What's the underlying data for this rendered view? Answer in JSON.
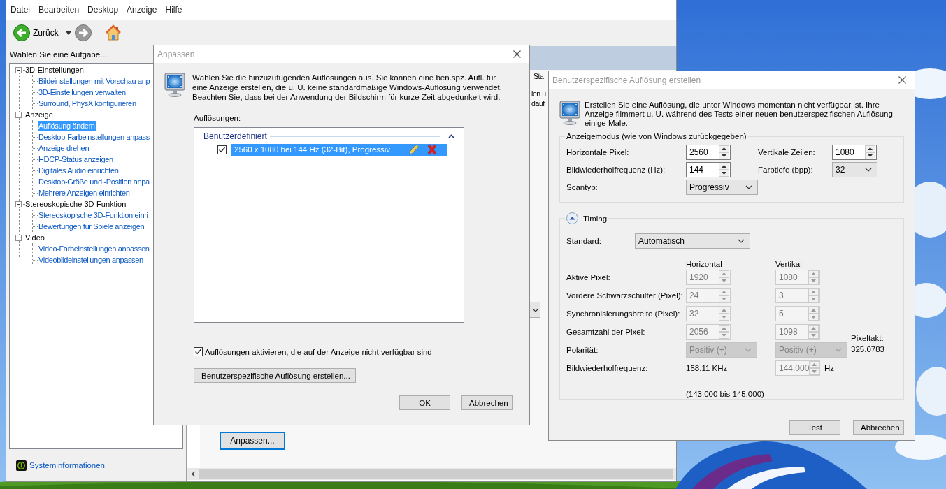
{
  "main_window": {
    "menu": [
      "Datei",
      "Bearbeiten",
      "Desktop",
      "Anzeige",
      "Hilfe"
    ],
    "toolbar": {
      "back": "Zurück"
    },
    "task_prompt": "Wählen Sie eine Aufgabe...",
    "tree": [
      {
        "label": "3D-Einstellungen",
        "expanded": true,
        "children": [
          {
            "label": "Bildeinstellungen mit Vorschau anp",
            "selected": false
          },
          {
            "label": "3D-Einstellungen verwalten",
            "selected": false
          },
          {
            "label": "Surround, PhysX konfigurieren",
            "selected": false
          }
        ]
      },
      {
        "label": "Anzeige",
        "expanded": true,
        "children": [
          {
            "label": "Auflösung ändern",
            "selected": true
          },
          {
            "label": "Desktop-Farbeinstellungen anpass",
            "selected": false
          },
          {
            "label": "Anzeige drehen",
            "selected": false
          },
          {
            "label": "HDCP-Status anzeigen",
            "selected": false
          },
          {
            "label": "Digitales Audio einrichten",
            "selected": false
          },
          {
            "label": "Desktop-Größe und -Position anpa",
            "selected": false
          },
          {
            "label": "Mehrere Anzeigen einrichten",
            "selected": false
          }
        ]
      },
      {
        "label": "Stereoskopische 3D-Funktion",
        "expanded": true,
        "children": [
          {
            "label": "Stereoskopische 3D-Funktion einri",
            "selected": false
          },
          {
            "label": "Bewertungen für Spiele anzeigen",
            "selected": false
          }
        ]
      },
      {
        "label": "Video",
        "expanded": true,
        "children": [
          {
            "label": "Video-Farbeinstellungen anpassen",
            "selected": false
          },
          {
            "label": "Videobildeinstellungen anpassen",
            "selected": false
          }
        ]
      }
    ],
    "footer_link": "Systeminformationen",
    "content": {
      "heading_fragment": "Sta",
      "text_fragments": [
        "len u",
        "dauf"
      ],
      "button": "Anpassen..."
    }
  },
  "customize_dialog": {
    "title": "Anpassen",
    "description": "Wählen Sie die hinzuzufügenden Auflösungen aus. Sie können eine ben.spz. Aufl. für eine Anzeige erstellen, die u. U. keine standardmäßige Windows-Auflösung verwendet. Beachten Sie, dass bei der Anwendung der Bildschirm für kurze Zeit abgedunkelt wird.",
    "list_label": "Auflösungen:",
    "groups": [
      {
        "label": "Benutzerdefiniert",
        "expanded": true,
        "items": [
          {
            "label": "2560 x 1080 bei 144 Hz (32-Bit), Progressiv",
            "checked": true,
            "selected": true
          }
        ]
      }
    ],
    "enable_checkbox": {
      "label": "Auflösungen aktivieren, die auf der Anzeige nicht verfügbar sind",
      "checked": true
    },
    "create_button": "Benutzerspezifische Auflösung erstellen...",
    "buttons": [
      "OK",
      "Abbrechen"
    ]
  },
  "custom_resolution_dialog": {
    "title": "Benutzerspezifische Auflösung erstellen",
    "description": "Erstellen Sie eine Auflösung, die unter Windows momentan nicht verfügbar ist. Ihre Anzeige flimmert u. U. während des Tests einer neuen benutzerspezifischen Auflösung einige Male.",
    "display_mode": {
      "title": "Anzeigemodus (wie von Windows zurückgegeben)",
      "fields": [
        {
          "kind": "spin",
          "label": "Horizontale Pixel:",
          "value": "2560"
        },
        {
          "kind": "spin",
          "label": "Vertikale Zeilen:",
          "value": "1080"
        },
        {
          "kind": "spin",
          "label": "Bildwiederholfrequenz (Hz):",
          "value": "144"
        },
        {
          "kind": "dropdown",
          "label": "Farbtiefe (bpp):",
          "value": "32"
        },
        {
          "kind": "dropdown",
          "label": "Scantyp:",
          "value": "Progressiv"
        }
      ]
    },
    "timing": {
      "title": "Timing",
      "expanded": true,
      "disabled": true,
      "standard": {
        "label": "Standard:",
        "value": "Automatisch"
      },
      "columns": [
        "Horizontal",
        "Vertikal"
      ],
      "rows": [
        {
          "kind": "spin",
          "label": "Aktive Pixel:",
          "horizontal": "1920",
          "vertical": "1080"
        },
        {
          "kind": "spin",
          "label": "Vordere Schwarzschulter (Pixel):",
          "horizontal": "24",
          "vertical": "3"
        },
        {
          "kind": "spin",
          "label": "Synchronisierungsbreite (Pixel):",
          "horizontal": "32",
          "vertical": "5"
        },
        {
          "kind": "spin",
          "label": "Gesamtzahl der Pixel:",
          "horizontal": "2056",
          "vertical": "1098"
        },
        {
          "kind": "dropdown",
          "label": "Polarität:",
          "horizontal": "Positiv (+)",
          "vertical": "Positiv (+)"
        },
        {
          "kind": "frequency",
          "label": "Bildwiederholfrequenz:",
          "horizontal": "158.11 KHz",
          "vertical": "144.000",
          "unit": "Hz",
          "range": "(143.000 bis 145.000)"
        }
      ],
      "pixel_clock": {
        "label": "Pixeltakt:",
        "value": "325.0783"
      }
    },
    "buttons": [
      "Test",
      "Abbrechen"
    ]
  }
}
